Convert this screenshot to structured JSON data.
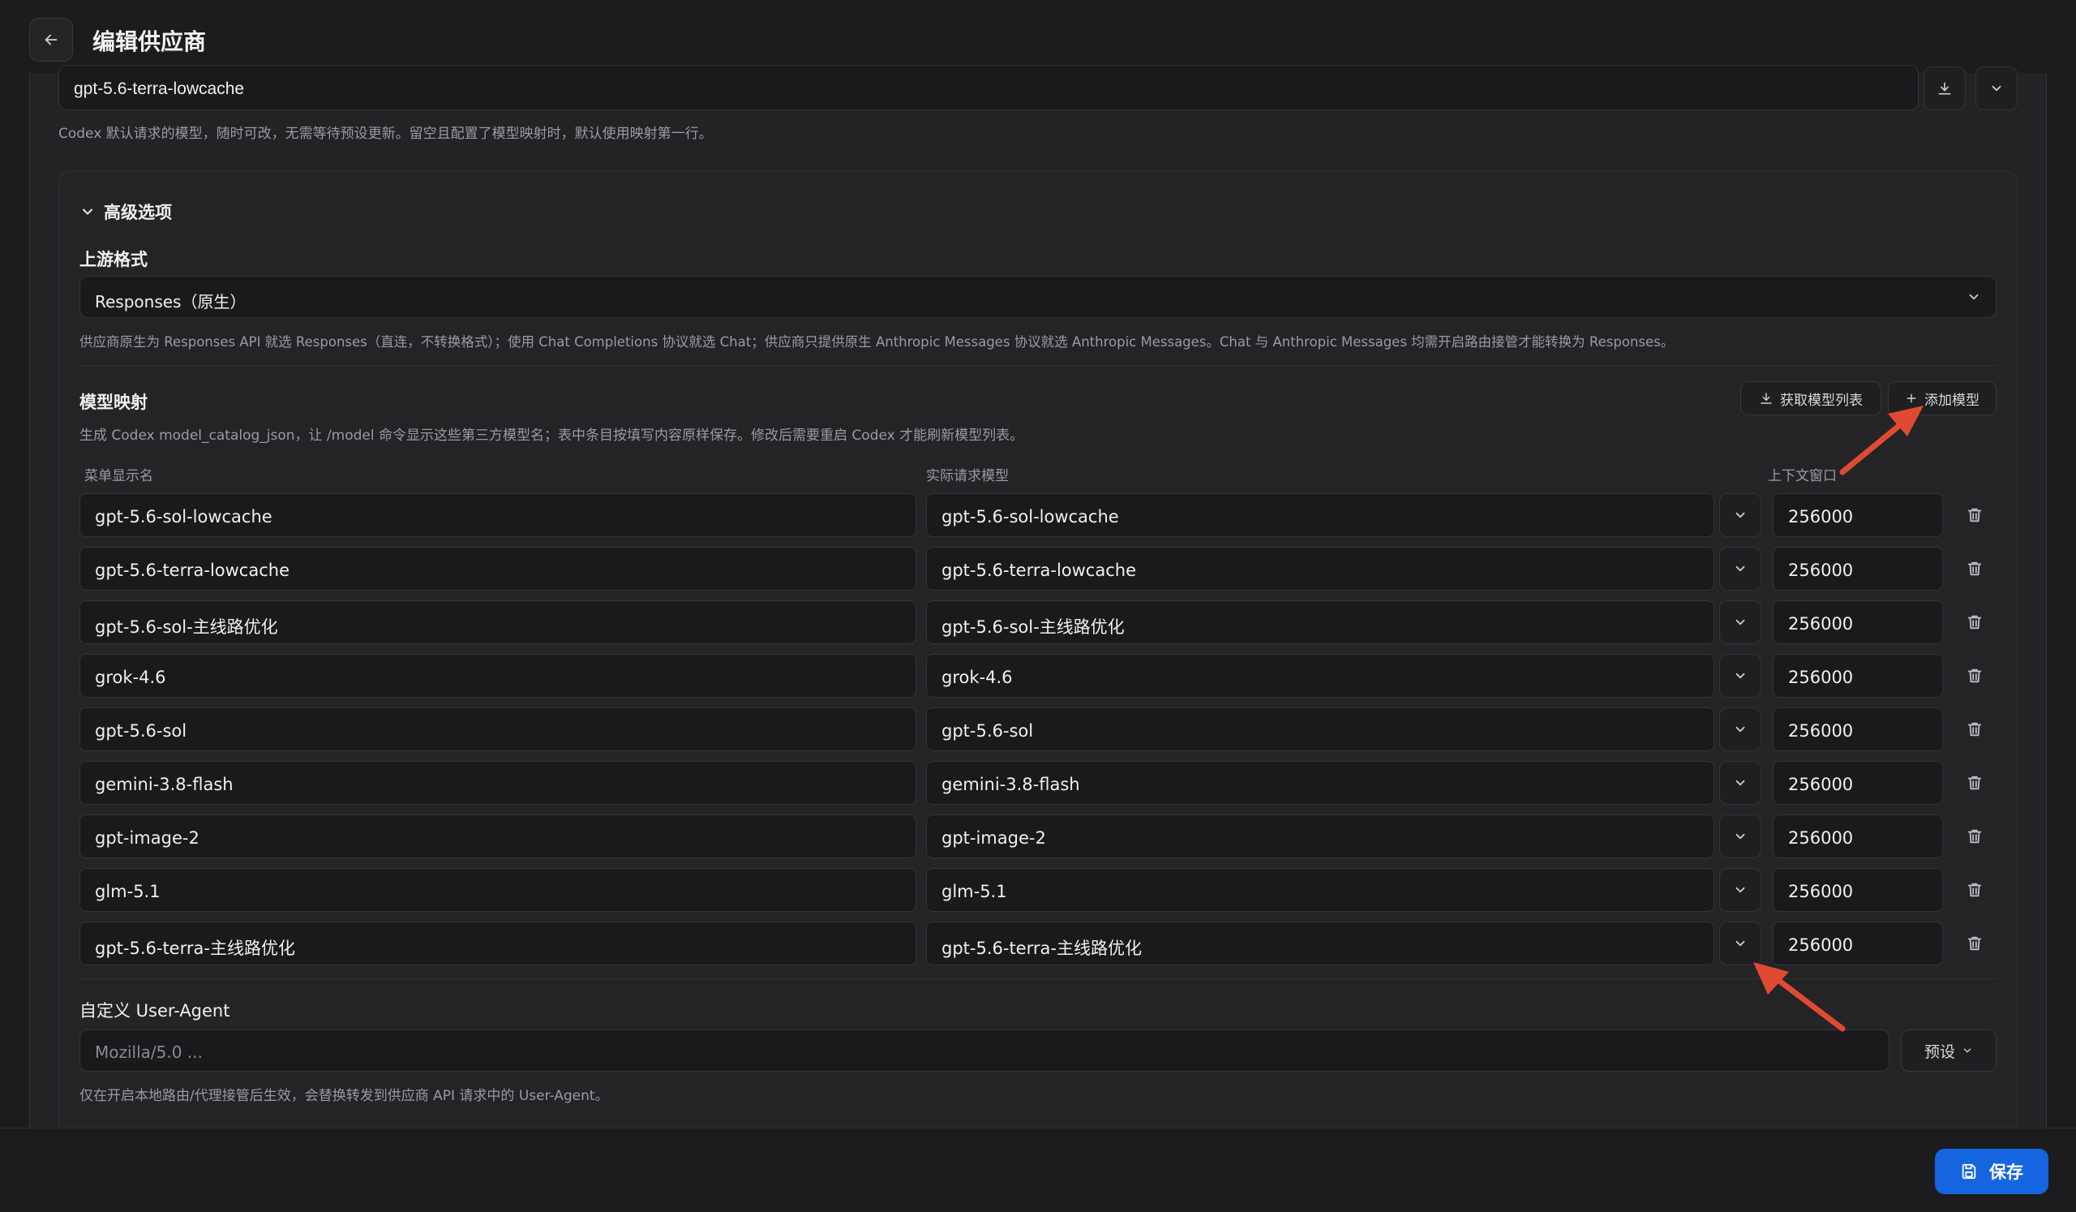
{
  "header": {
    "title": "编辑供应商"
  },
  "default_model": {
    "value": "gpt-5.6-terra-lowcache",
    "hint": "Codex 默认请求的模型，随时可改，无需等待预设更新。留空且配置了模型映射时，默认使用映射第一行。"
  },
  "advanced": {
    "toggle_label": "高级选项",
    "upstream_format": {
      "label": "上游格式",
      "selected": "Responses（原生）",
      "hint": "供应商原生为 Responses API 就选 Responses（直连，不转换格式）；使用 Chat Completions 协议就选 Chat；供应商只提供原生 Anthropic Messages 协议就选 Anthropic Messages。Chat 与 Anthropic Messages 均需开启路由接管才能转换为 Responses。"
    },
    "model_mapping": {
      "label": "模型映射",
      "hint": "生成 Codex model_catalog_json，让 /model 命令显示这些第三方模型名；表中条目按填写内容原样保存。修改后需要重启 Codex 才能刷新模型列表。",
      "fetch_button": "获取模型列表",
      "add_button": "添加模型",
      "columns": {
        "display": "菜单显示名",
        "actual": "实际请求模型",
        "context": "上下文窗口"
      },
      "rows": [
        {
          "display": "gpt-5.6-sol-lowcache",
          "actual": "gpt-5.6-sol-lowcache",
          "context": "256000"
        },
        {
          "display": "gpt-5.6-terra-lowcache",
          "actual": "gpt-5.6-terra-lowcache",
          "context": "256000"
        },
        {
          "display": "gpt-5.6-sol-主线路优化",
          "actual": "gpt-5.6-sol-主线路优化",
          "context": "256000"
        },
        {
          "display": "grok-4.6",
          "actual": "grok-4.6",
          "context": "256000"
        },
        {
          "display": "gpt-5.6-sol",
          "actual": "gpt-5.6-sol",
          "context": "256000"
        },
        {
          "display": "gemini-3.8-flash",
          "actual": "gemini-3.8-flash",
          "context": "256000"
        },
        {
          "display": "gpt-image-2",
          "actual": "gpt-image-2",
          "context": "256000"
        },
        {
          "display": "glm-5.1",
          "actual": "glm-5.1",
          "context": "256000"
        },
        {
          "display": "gpt-5.6-terra-主线路优化",
          "actual": "gpt-5.6-terra-主线路优化",
          "context": "256000"
        }
      ]
    },
    "user_agent": {
      "label": "自定义 User-Agent",
      "placeholder": "Mozilla/5.0 ...",
      "preset_button": "预设",
      "hint": "仅在开启本地路由/代理接管后生效，会替换转发到供应商 API 请求中的 User-Agent。"
    }
  },
  "footer": {
    "save_label": "保存"
  },
  "colors": {
    "accent": "#1665e0",
    "annotation_arrow": "#e04a32"
  }
}
